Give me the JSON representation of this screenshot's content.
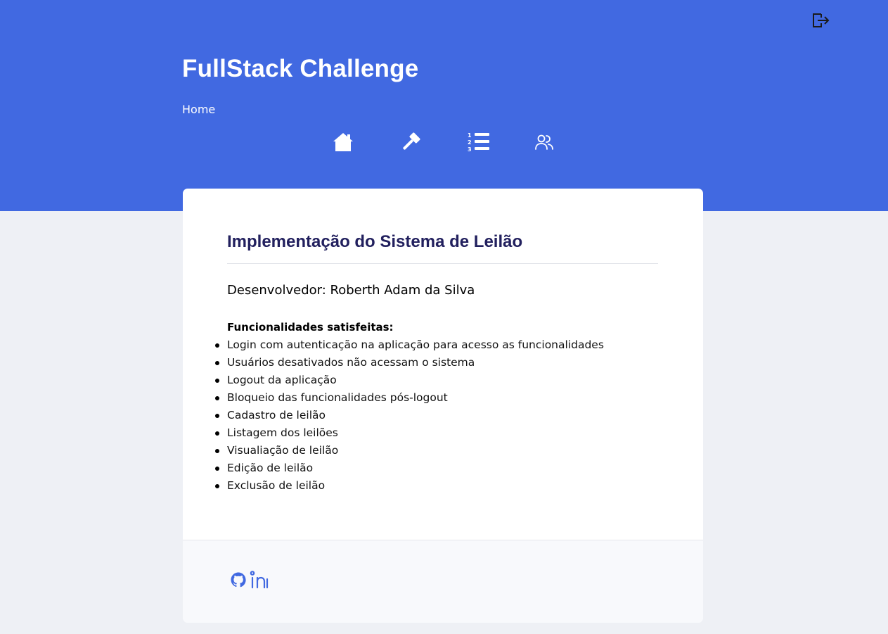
{
  "header": {
    "app_title": "FullStack Challenge",
    "breadcrumb": "Home",
    "logout_icon": "logout-icon",
    "nav": [
      {
        "icon": "home-icon"
      },
      {
        "icon": "gavel-icon"
      },
      {
        "icon": "ordered-list-icon"
      },
      {
        "icon": "users-icon"
      }
    ]
  },
  "card": {
    "title": "Implementação do Sistema de Leilão",
    "developer": "Desenvolvedor: Roberth Adam da Silva",
    "features_heading": "Funcionalidades satisfeitas:",
    "features": [
      "Login com autenticação na aplicação para acesso as funcionalidades",
      "Usuários desativados não acessam o sistema",
      "Logout da aplicação",
      "Bloqueio das funcionalidades pós-logout",
      "Cadastro de leilão",
      "Listagem dos leilões",
      "Visualiação de leilão",
      "Edição de leilão",
      "Exclusão de leilão"
    ]
  },
  "footer": {
    "links": [
      {
        "icon": "github-icon"
      },
      {
        "icon": "linkedin-icon"
      }
    ]
  },
  "colors": {
    "header_bg": "#4169e1",
    "page_bg": "#eef0f5",
    "title_color": "#22205e",
    "icon_accent": "#4169e1"
  }
}
